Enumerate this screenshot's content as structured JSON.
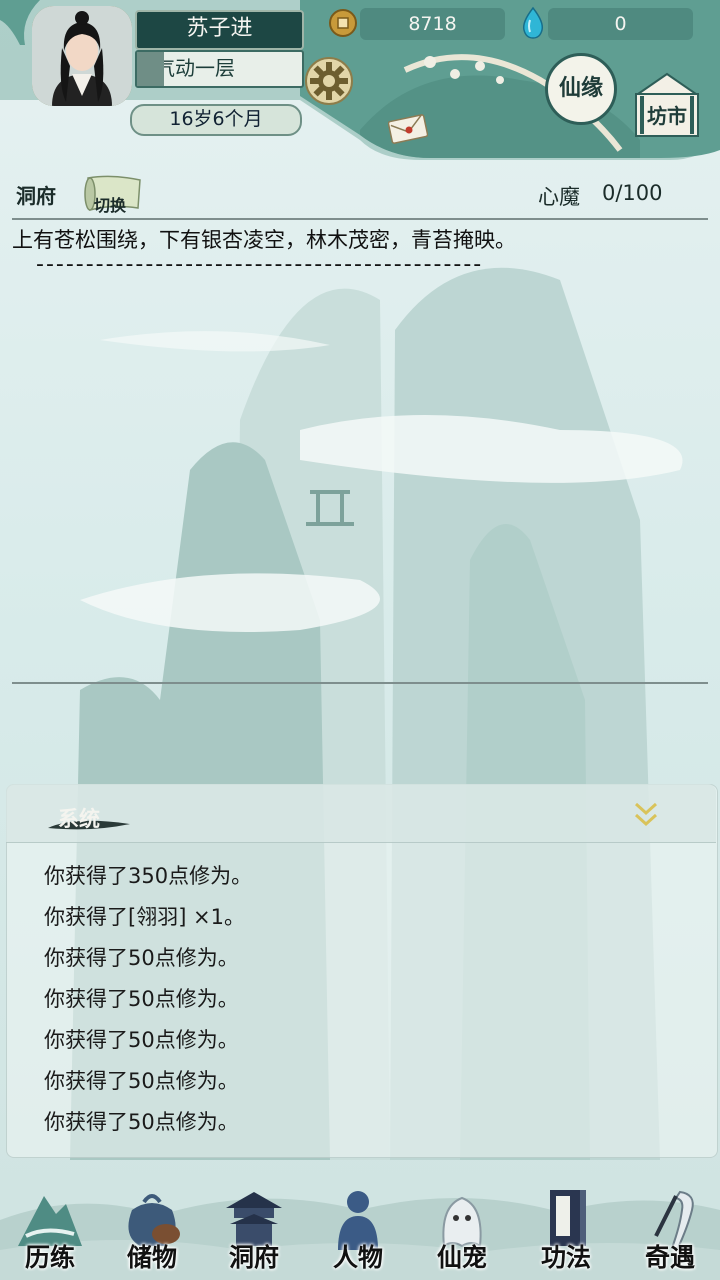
{
  "player": {
    "name": "苏子进",
    "realm": "气动一层",
    "age": "16岁6个月",
    "realm_progress": 0.18
  },
  "currency": {
    "coins": "8718",
    "gems": "0"
  },
  "header_buttons": {
    "xianyuan": "仙缘",
    "fangshi": "坊市"
  },
  "location": {
    "label": "洞府",
    "switch": "切换",
    "xinmo_label": "心魔",
    "xinmo_value": "0/100"
  },
  "description": "上有苍松围绕，下有银杏凌空，林木茂密，青苔掩映。",
  "separator": "---------------------------------------------",
  "system": {
    "title": "系统",
    "messages": [
      "你获得了350点修为。",
      "你获得了[翎羽] ×1。",
      "你获得了50点修为。",
      "你获得了50点修为。",
      "你获得了50点修为。",
      "你获得了50点修为。",
      "你获得了50点修为。"
    ]
  },
  "nav": [
    {
      "label": "历练",
      "icon": "mountain-icon"
    },
    {
      "label": "储物",
      "icon": "bag-icon"
    },
    {
      "label": "洞府",
      "icon": "pavilion-icon"
    },
    {
      "label": "人物",
      "icon": "person-icon"
    },
    {
      "label": "仙宠",
      "icon": "ghost-pet-icon"
    },
    {
      "label": "功法",
      "icon": "book-icon"
    },
    {
      "label": "奇遇",
      "icon": "crane-icon"
    }
  ],
  "colors": {
    "header_bg": "#5f9e92",
    "panel_bg": "#eef5f4",
    "accent": "#1d4744",
    "gold": "#c6b98c"
  }
}
